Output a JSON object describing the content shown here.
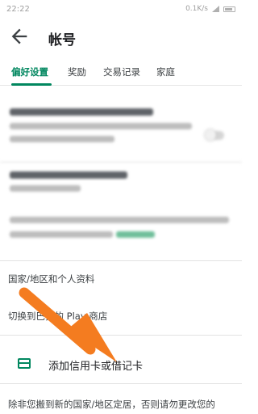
{
  "status_bar": {
    "time": "22:22",
    "network_speed": "0.1K/s"
  },
  "header": {
    "title": "帐号"
  },
  "tabs": [
    {
      "label": "偏好设置",
      "active": true
    },
    {
      "label": "奖励",
      "active": false
    },
    {
      "label": "交易记录",
      "active": false
    },
    {
      "label": "家庭",
      "active": false
    }
  ],
  "rows": {
    "country_profile": "国家/地区和个人资料",
    "switch_store": "切换到巴拉的 Play 商店",
    "add_card": "添加信用卡或借记卡",
    "footer_notice": "除非您搬到新的国家/地区定居，否则请勿更改您的"
  },
  "colors": {
    "accent": "#01875f",
    "annotation_arrow": "#f47c20"
  },
  "icons": {
    "back": "arrow-left",
    "card": "credit-card",
    "annotation": "pointing-arrow"
  }
}
